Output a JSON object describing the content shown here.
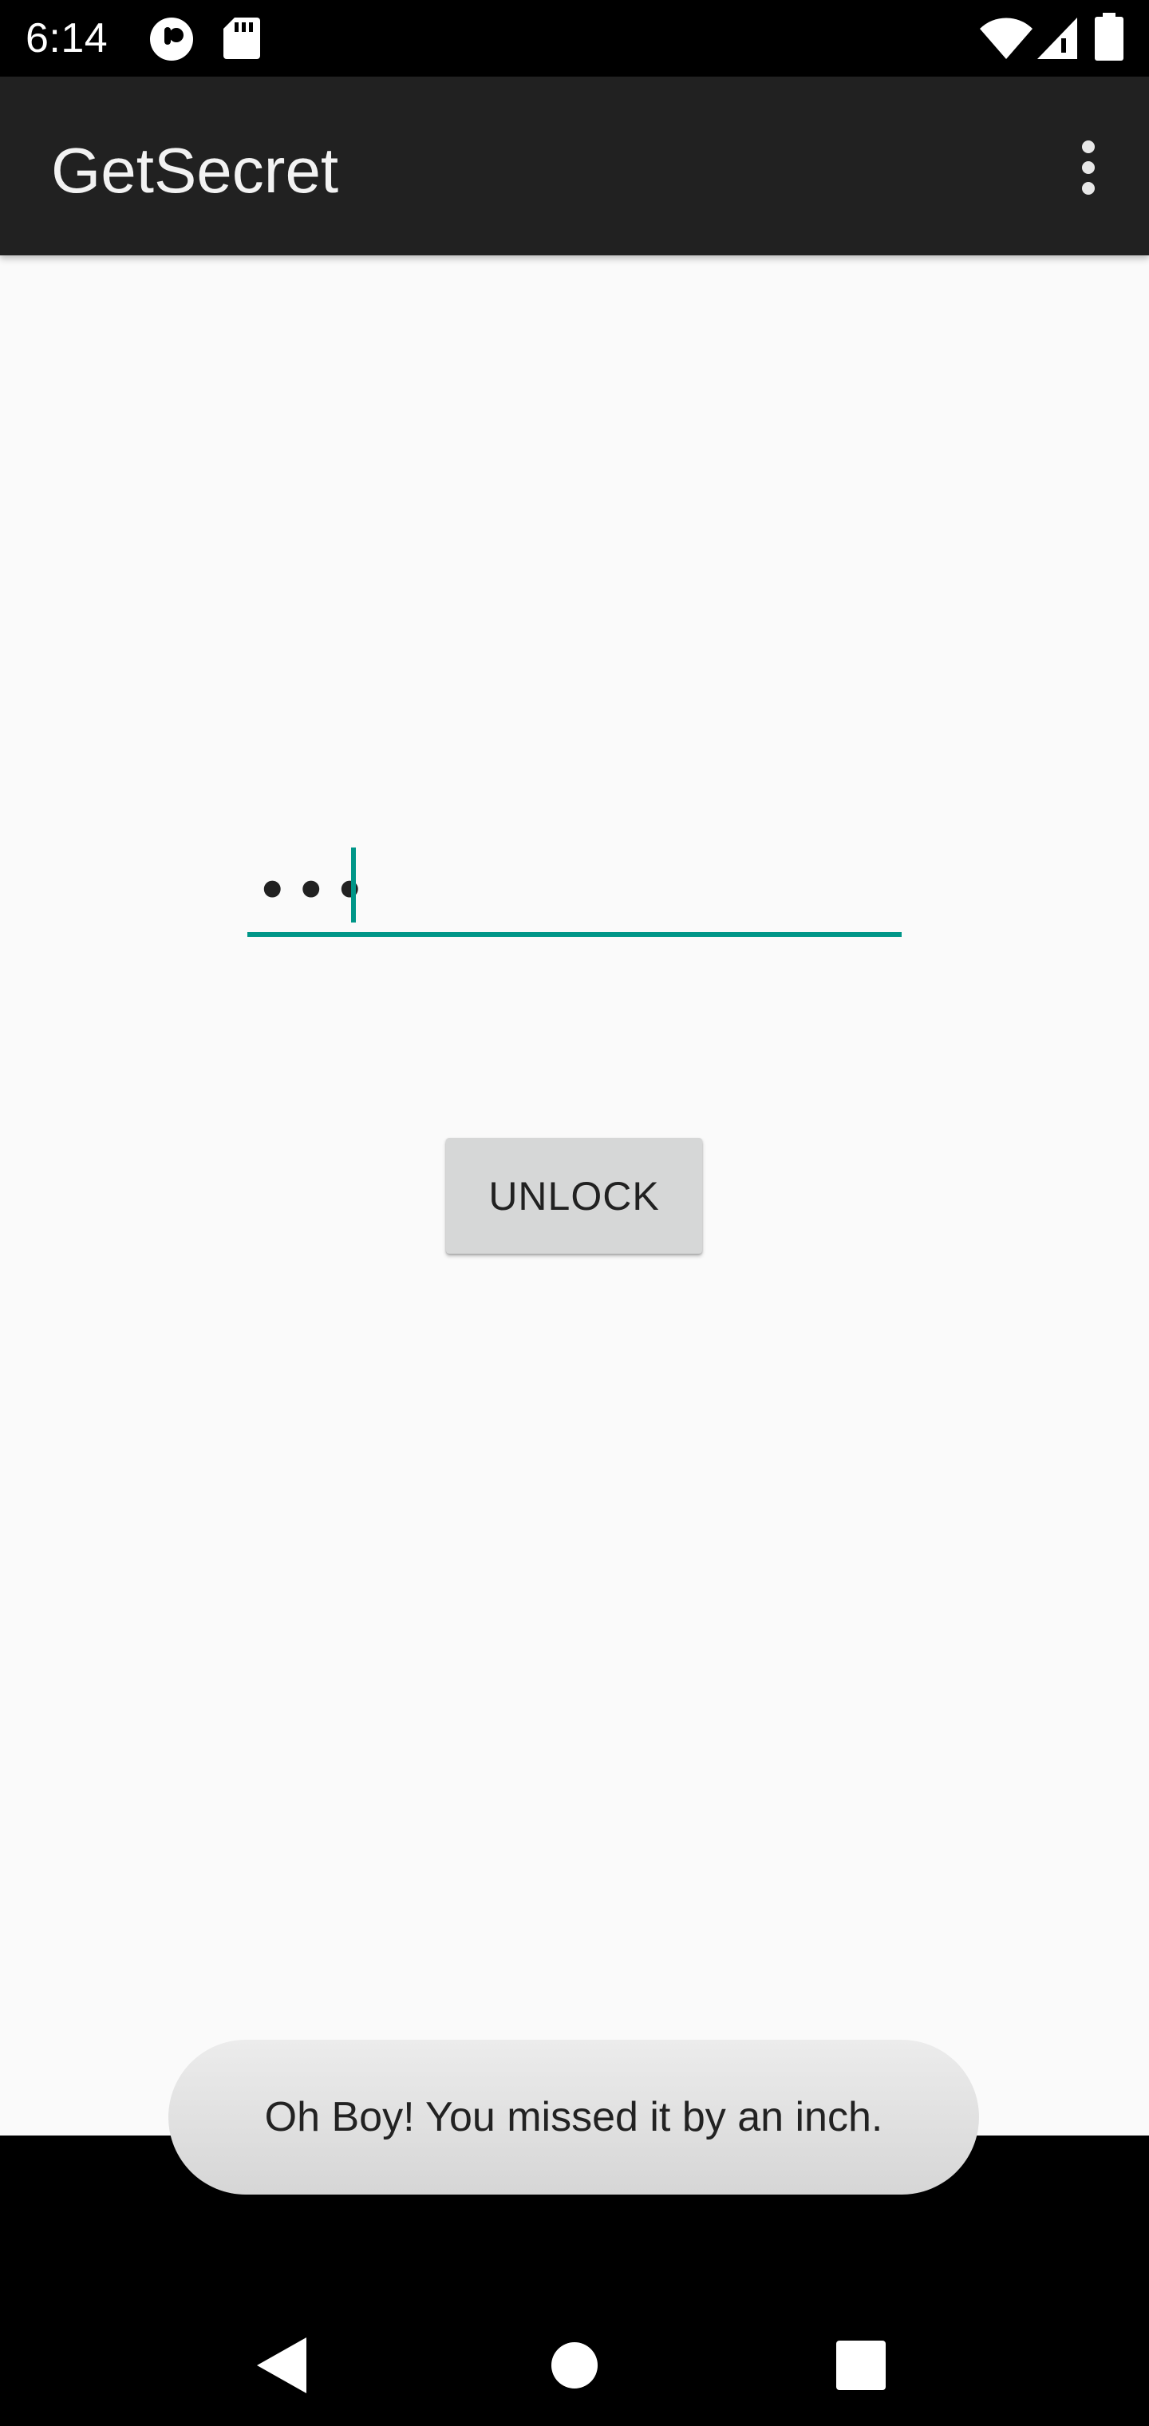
{
  "status_bar": {
    "time": "6:14",
    "icons": [
      "notification-app-icon",
      "sd-card-icon",
      "wifi-icon",
      "signal-icon",
      "battery-icon"
    ]
  },
  "app_bar": {
    "title": "GetSecret",
    "menu_icon": "more-vert-icon"
  },
  "form": {
    "password_value": "•••",
    "unlock_label": "UNLOCK"
  },
  "toast": {
    "message": "Oh Boy! You missed it by an inch."
  },
  "nav_bar": {
    "icons": [
      "back-icon",
      "home-icon",
      "recents-icon"
    ]
  },
  "colors": {
    "accent": "#009688",
    "app_bar": "#212121",
    "background": "#fafafa",
    "button": "#d6d7d7"
  }
}
